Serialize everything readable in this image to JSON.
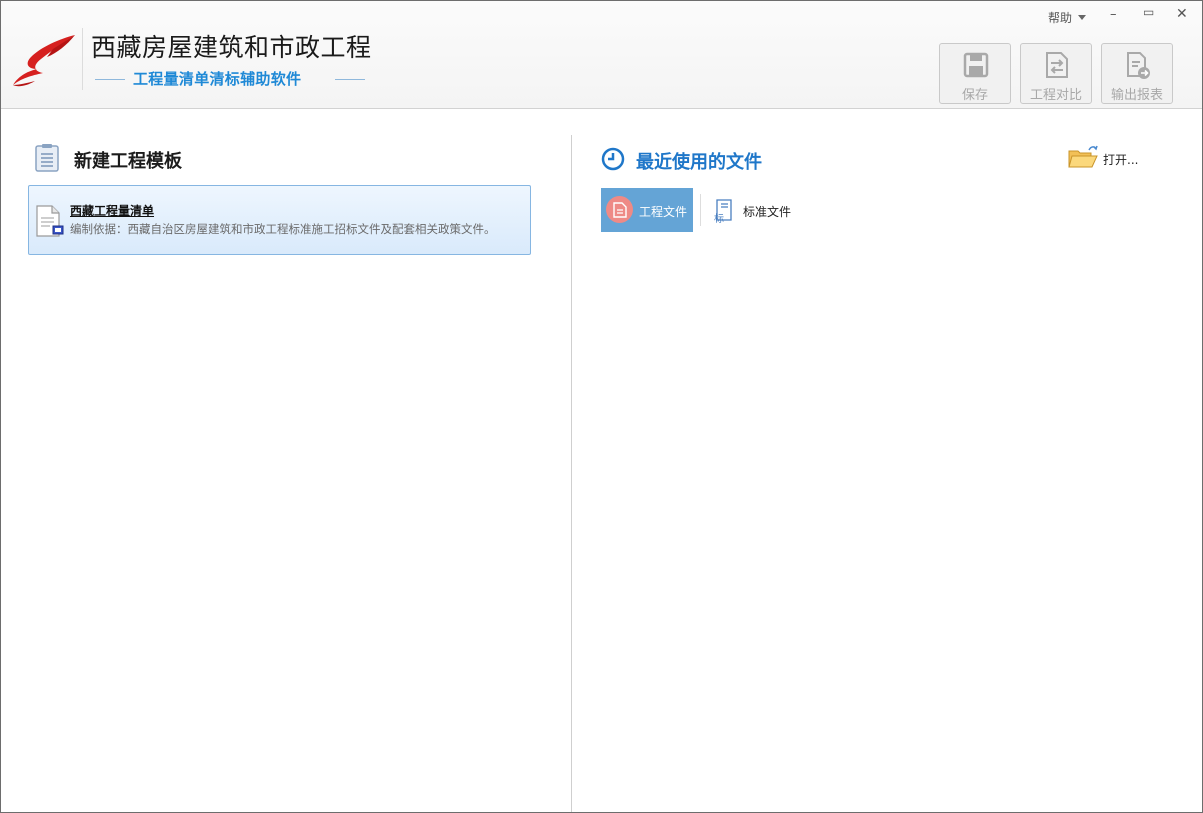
{
  "app": {
    "title": "西藏房屋建筑和市政工程",
    "subtitle": "工程量清单清标辅助软件"
  },
  "window_controls": {
    "help_label": "帮助",
    "minimize": "–",
    "maximize": "▭",
    "close": "✕"
  },
  "toolbar": {
    "save_label": "保存",
    "compare_label": "工程对比",
    "export_label": "输出报表"
  },
  "left_panel": {
    "title": "新建工程模板",
    "templates": [
      {
        "name": "西藏工程量清单",
        "description": "编制依据：西藏自治区房屋建筑和市政工程标准施工招标文件及配套相关政策文件。"
      }
    ]
  },
  "right_panel": {
    "title": "最近使用的文件",
    "open_label": "打开...",
    "tabs": [
      {
        "label": "工程文件",
        "selected": true
      },
      {
        "label": "标准文件",
        "selected": false
      }
    ]
  },
  "colors": {
    "accent_blue": "#1f77c9",
    "tab_selected": "#64a4d6",
    "logo_red": "#d6201f"
  }
}
